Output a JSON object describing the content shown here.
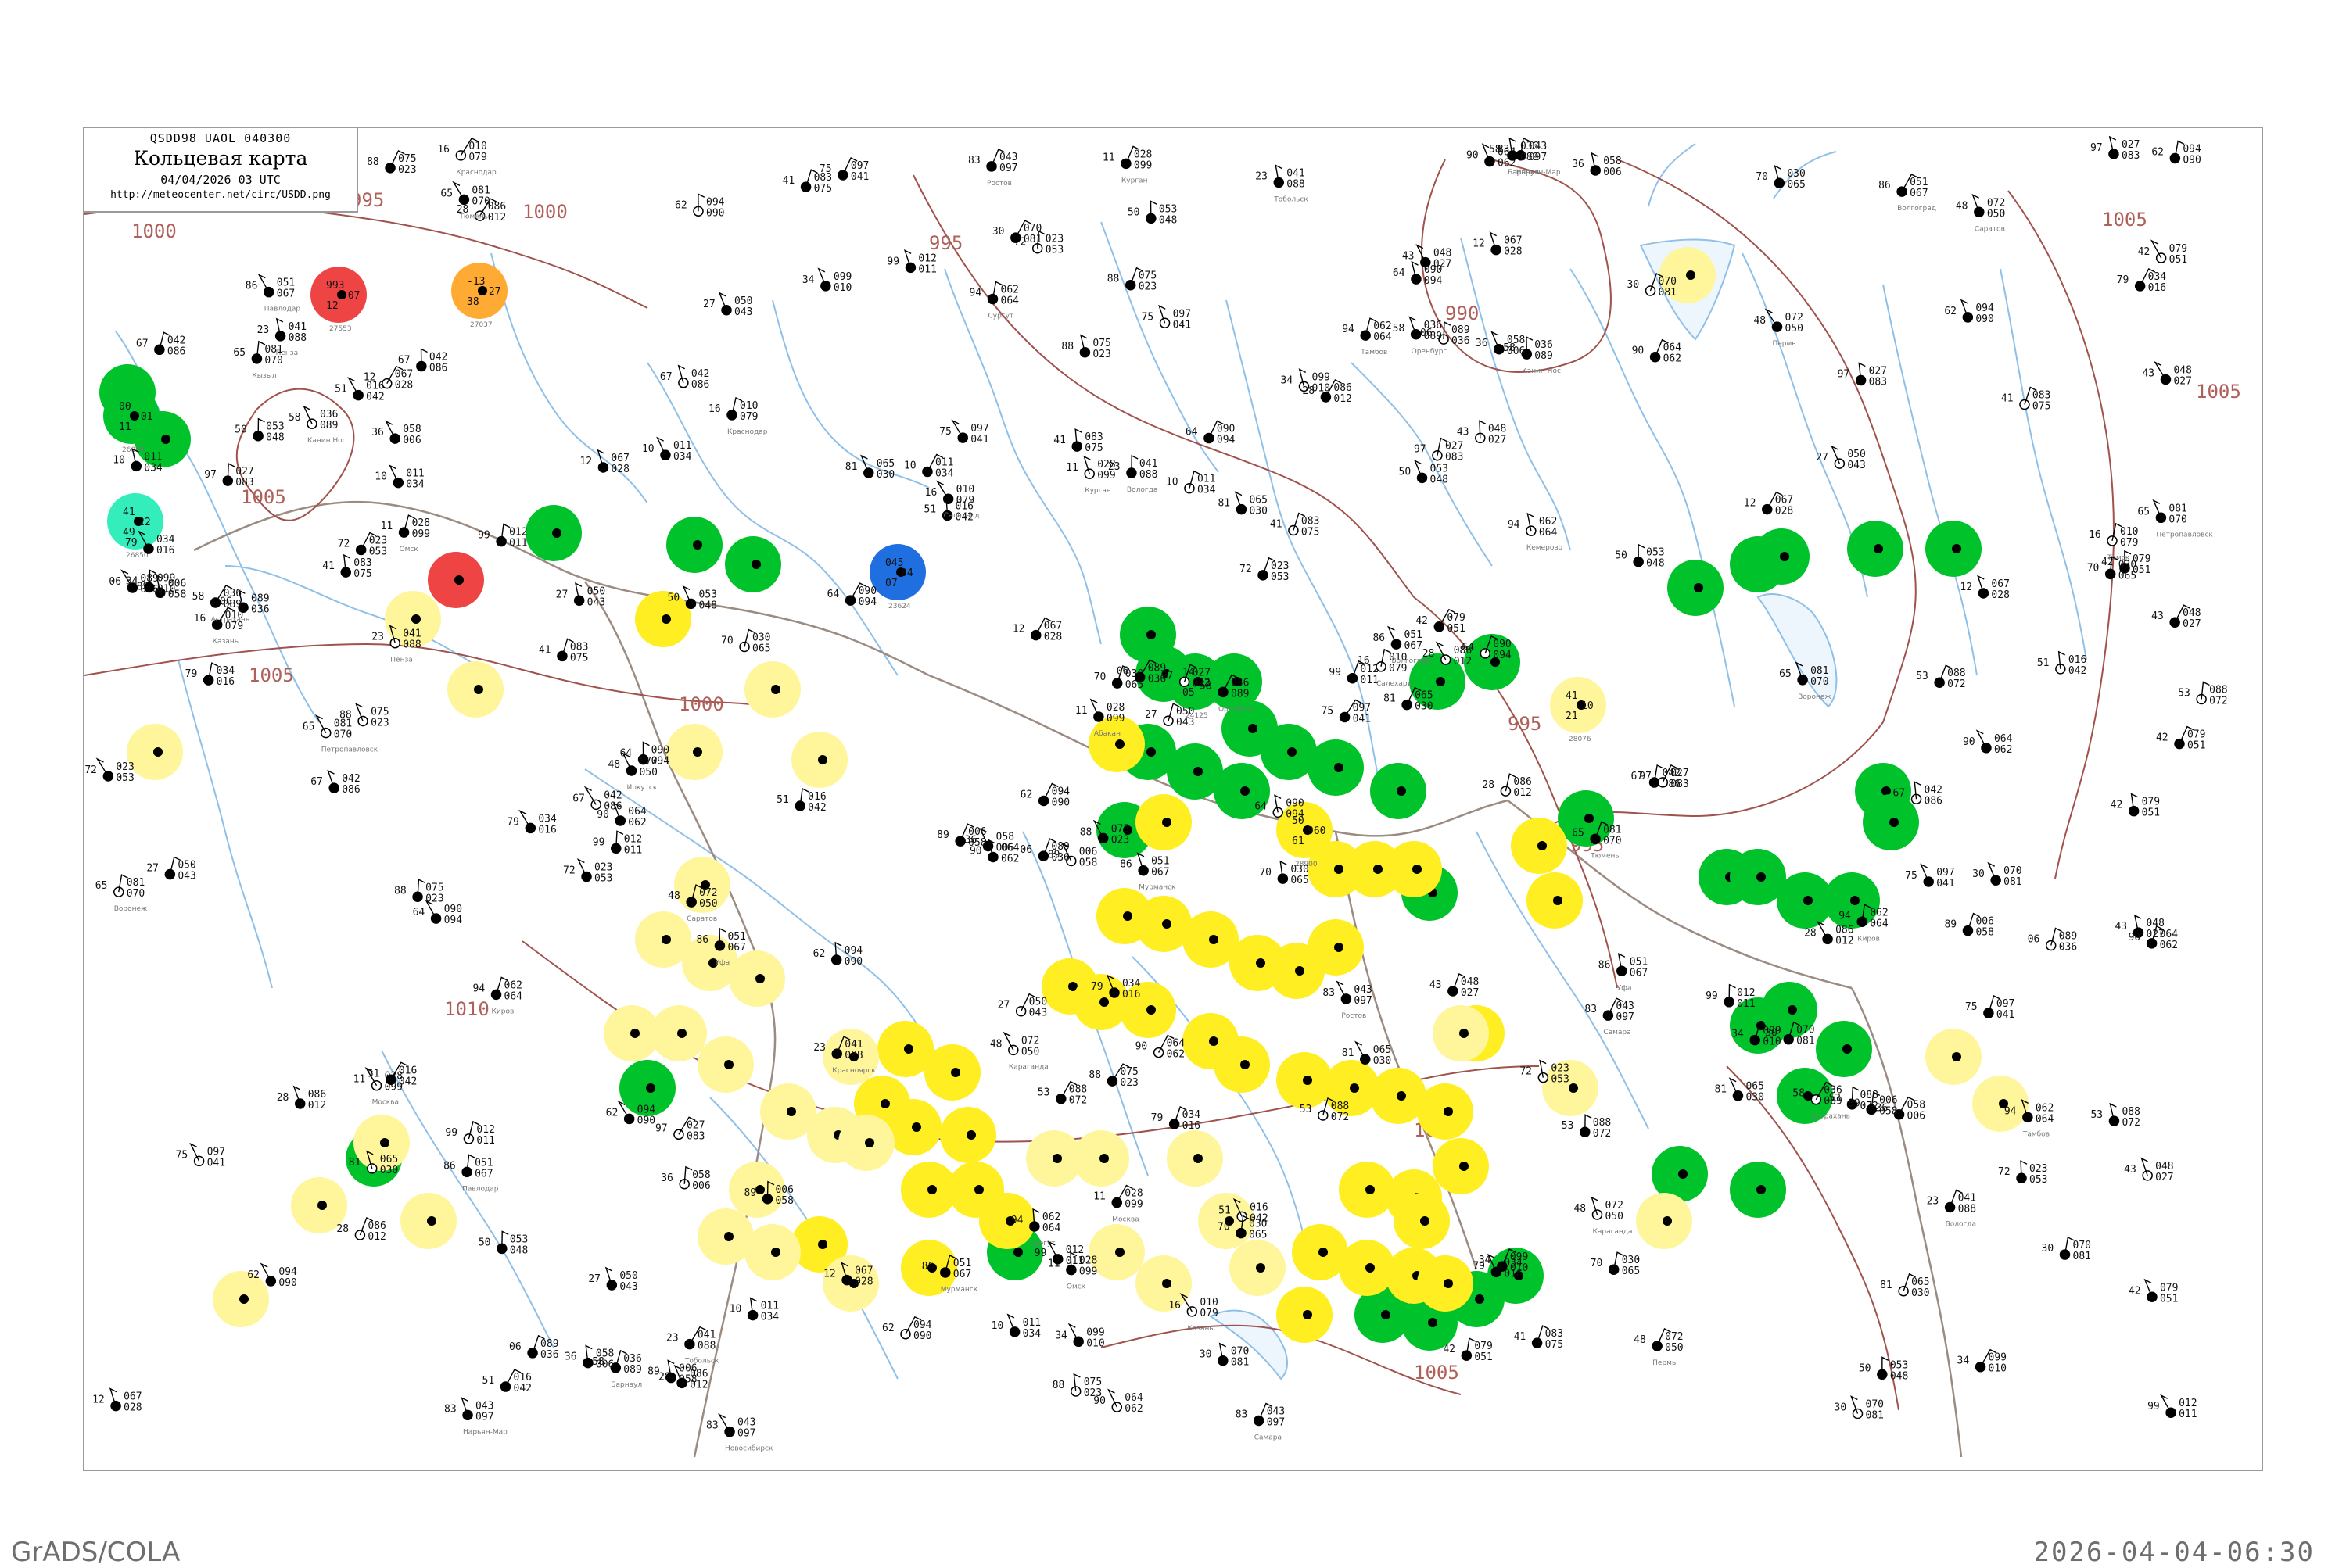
{
  "header": {
    "codes": "QSDD98  UAOL  040300",
    "title": "Кольцевая карта",
    "date": "04/04/2026 03 UTC",
    "url": "http://meteocenter.net/circ/USDD.png"
  },
  "footer": {
    "left": "GrADS/COLA",
    "right": "2026-04-04-06:30"
  },
  "colors": {
    "isobar": "#a0524d",
    "river": "#8fc0e8",
    "frame": "#9a9a9a",
    "station_green": "#00c22a",
    "station_yellow": "#ffee22",
    "station_lightyellow": "#fff59a",
    "station_red": "#ee4444",
    "station_orange": "#ffaa33",
    "station_blue": "#1f6fe0",
    "station_cyan": "#33eebb"
  },
  "map": {
    "isobar_labels": [
      "995",
      "1000",
      "1005",
      "1000",
      "1005",
      "990",
      "995",
      "995",
      "1000",
      "1005",
      "1005",
      "1010",
      "995",
      "995",
      "1000",
      "1005"
    ],
    "highlighted_stations": [
      {
        "category": "red",
        "values": [
          "993",
          "-07",
          "12"
        ],
        "name": "27553"
      },
      {
        "category": "orange",
        "values": [
          "-13",
          "-27",
          "38"
        ],
        "name": "27037"
      },
      {
        "category": "green",
        "values": [
          "00",
          "-01",
          "11"
        ],
        "name": "26060"
      },
      {
        "category": "cyan",
        "values": [
          "41",
          "22",
          "49"
        ],
        "name": "26850"
      },
      {
        "category": "blue",
        "values": [
          "045",
          "04",
          "07"
        ],
        "name": "23624"
      },
      {
        "category": "green",
        "values": [
          "14",
          "22",
          "05"
        ],
        "name": "24125"
      },
      {
        "category": "yellow",
        "values": [
          "50",
          "960",
          "61"
        ],
        "name": "28900"
      },
      {
        "category": "lightyellow",
        "values": [
          "41",
          "10",
          "21"
        ],
        "name": "28076"
      }
    ],
    "station_numbers": [
      "051",
      "094",
      "012",
      "067",
      "036",
      "086",
      "075",
      "064",
      "043",
      "023",
      "090",
      "050",
      "010",
      "058",
      "034",
      "079",
      "062",
      "011",
      "027",
      "070",
      "041",
      "083",
      "006",
      "097",
      "028",
      "065",
      "042",
      "099",
      "081",
      "016",
      "053",
      "089",
      "072",
      "048",
      "030",
      "088"
    ],
    "station_names": [
      "Мурманск",
      "Канин Нос",
      "Нарьян-Мар",
      "Салехард",
      "Сургут",
      "Тобольск",
      "Омск",
      "Тюмень",
      "Пермь",
      "Уфа",
      "Оренбург",
      "Самара",
      "Казань",
      "Киров",
      "Вологда",
      "Москва",
      "Воронеж",
      "Саратов",
      "Волгоград",
      "Астрахань",
      "Ростов",
      "Краснодар",
      "Тамбов",
      "Пенза",
      "Курган",
      "Петропавловск",
      "Караганда",
      "Павлодар",
      "Барнаул",
      "Новосибирск",
      "Томск",
      "Кемерово",
      "Красноярск",
      "Абакан",
      "Кызыл",
      "Иркутск"
    ]
  }
}
